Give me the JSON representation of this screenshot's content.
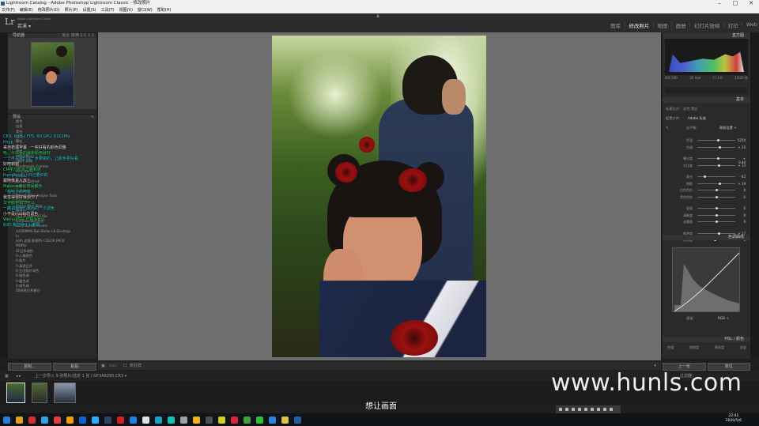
{
  "window": {
    "title": "Lightroom Catalog - Adobe Photoshop Lightroom Classic - 修改照片"
  },
  "menu": [
    "文件(F)",
    "编辑(E)",
    "修改照片(D)",
    "照片(P)",
    "设置(S)",
    "工具(T)",
    "视图(V)",
    "窗口(W)",
    "帮助(H)"
  ],
  "app": {
    "logo": "Lr",
    "product": "Adobe Lightroom Classic",
    "user": "若溪 ▾"
  },
  "modules": [
    "图库",
    "修改照片",
    "地图",
    "画册",
    "幻灯片放映",
    "打印",
    "Web"
  ],
  "modules_active": "修改照片",
  "left": {
    "navigator_label": "导航器",
    "nav_zoom": "适合  填满  1:1  1:2",
    "presets_label": "预设",
    "presets": [
      "颜色",
      "创意",
      "黑白",
      "曲线",
      "颗粒",
      "锐化",
      "晕影",
      "0预设(默认)",
      "1胶片-风格",
      "FilmPresets_Frames",
      "Film Warm",
      "Portra",
      "Kodak Portrait",
      "Nordic Travel",
      "Outdoor",
      "Editorial & Lifestyle Tools",
      "fujinoul",
      "happy New Year",
      "HRE日",
      "VCP-Presets-2016a",
      "kindness调色系列",
      "Lady Byrne Presets",
      "LOOKMMS-Bali-Baller-LR-Desktop",
      "lu",
      "sofri 滤镜 影视PS COLOR PACK",
      "MOMU",
      "SF日系调色",
      "0-人像肤色",
      "0-胶片",
      "0-清透日系",
      "0-生活照片调色",
      "0-暗色调",
      "0-暖色调",
      "0-绿色调",
      "SB系统日系夏日"
    ],
    "btn_copy": "复制...",
    "btn_paste": "粘贴"
  },
  "overlay": {
    "stats": "CPU: 0(0%)    FPS: 60    GPU: 6101Mb",
    "lines": [
      "tinyy",
      "来自若溪字幕 · 一些好看的颜色调整",
      "哈，什么我的最新颜色就好",
      "一个不在我们这一步要做的，让颜色更好看",
      "好吧谢谢",
      "CM学习成长之路频道",
      "Pumpkin的小日记要红的",
      "跟随像素人放上",
      "Makeup第一时间颜色",
      "「哈哈」的可能",
      "我觉得很好我调节了",
      "文字颜色调节可以",
      "一路调整我们最后的一次调色",
      "小不是mode的调色",
      "Wecuu你好 已把为什么",
      "好的 我觉得什么都做"
    ]
  },
  "canvas_toolbar": {
    "label": "软打样"
  },
  "right": {
    "histogram_label": "直方图",
    "histo_meta": [
      "ISO 200",
      "35 mm",
      "f / 2.0",
      "1/320 秒"
    ],
    "basic_label": "基本",
    "profile_label": "配置文件:",
    "profile_value": "Adobe 标准",
    "treatment": "处理方式：  彩色   黑白",
    "wb_label": "白平衡：",
    "wb_value": "原照设置 ÷",
    "sliders": [
      {
        "label": "色温",
        "value": "5250",
        "pos": 0.55
      },
      {
        "label": "色调",
        "value": "+ 15",
        "pos": 0.6
      },
      {
        "label": "曝光度",
        "value": "+ 0.40",
        "pos": 0.56
      },
      {
        "label": "对比度",
        "value": "+ 13",
        "pos": 0.57
      },
      {
        "label": "高光",
        "value": "- 62",
        "pos": 0.2
      },
      {
        "label": "阴影",
        "value": "+ 19",
        "pos": 0.6
      },
      {
        "label": "白色色阶",
        "value": "0",
        "pos": 0.5
      },
      {
        "label": "黑色色阶",
        "value": "0",
        "pos": 0.5
      },
      {
        "label": "纹理",
        "value": "0",
        "pos": 0.5
      },
      {
        "label": "清晰度",
        "value": "0",
        "pos": 0.5
      },
      {
        "label": "去朦胧",
        "value": "0",
        "pos": 0.5
      },
      {
        "label": "鲜艳度",
        "value": "+ 17",
        "pos": 0.58
      },
      {
        "label": "饱和度",
        "value": "- 5",
        "pos": 0.47
      }
    ],
    "curve_label": "色调曲线",
    "curve_channel": "通道：",
    "curve_channel_value": "RGB ÷",
    "hsl_label": "HSL / 颜色",
    "hsl_tabs": [
      "色相",
      "饱和度",
      "明亮度",
      "全部"
    ],
    "btn_prev": "上一张",
    "btn_reset": "复位"
  },
  "filmstrip": {
    "path": "上一次导入  9 张照片/选定 1 张 / GF3A8285.CR3 ▾",
    "filter": "过滤器："
  },
  "subtitle": "想让画面",
  "watermark": "www.hunls.com",
  "clock": {
    "time": "22:41",
    "date": "2020/5/6"
  }
}
